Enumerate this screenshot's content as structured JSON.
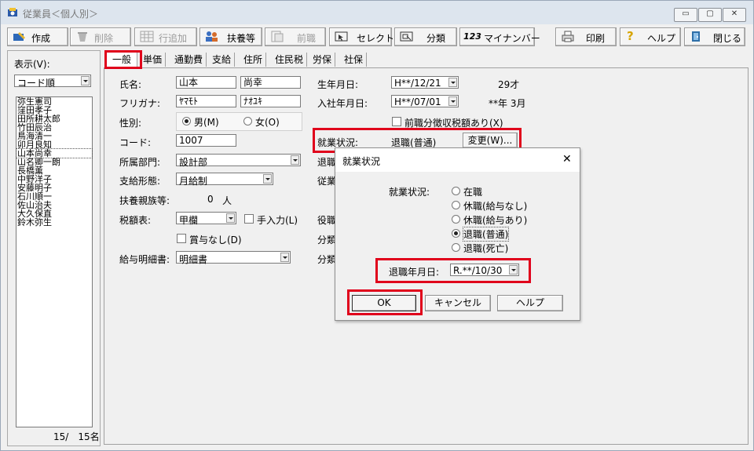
{
  "window": {
    "title": "従業員＜個人別＞",
    "minimize": "▭",
    "restore": "▢",
    "close": "✕"
  },
  "toolbar": {
    "create": "作成",
    "delete": "削除",
    "add_row": "行追加",
    "dependents": "扶養等",
    "prev_job": "前職",
    "select": "セレクト",
    "classify": "分類",
    "mynumber_icon_text": "123",
    "mynumber": "マイナンバー",
    "print": "印刷",
    "help": "ヘルプ",
    "close": "閉じる"
  },
  "left_panel": {
    "display_label": "表示(V):",
    "sort": "コード順",
    "employees": [
      "弥生憲司",
      "窪田孝子",
      "田所耕太郎",
      "竹田辰治",
      "鳥海清一",
      "卯月良知",
      "山本尚幸",
      "山名卿一朗",
      "長橋薫",
      "中野洋子",
      "安藤明子",
      "石川順一",
      "佐山治夫",
      "大久保直",
      "鈴木弥生"
    ],
    "count": "15/　15名"
  },
  "tabs": [
    "一般",
    "単価",
    "通勤費",
    "支給",
    "住所",
    "住民税",
    "労保",
    "社保"
  ],
  "form": {
    "name_label": "氏名:",
    "last_name": "山本",
    "first_name": "尚幸",
    "kana_label": "フリガナ:",
    "last_kana": "ﾔﾏﾓﾄ",
    "first_kana": "ﾅｵﾕｷ",
    "gender_label": "性別:",
    "male": "男(M)",
    "female": "女(O)",
    "code_label": "コード:",
    "code": "1007",
    "dept_label": "所属部門:",
    "dept": "設計部",
    "pay_label": "支給形態:",
    "pay": "月給制",
    "dependents_label": "扶養親族等:",
    "dependents_count": "0",
    "dependents_unit": "人",
    "tax_label": "税額表:",
    "tax": "甲欄",
    "manual_input": "手入力(L)",
    "no_bonus": "賞与なし(D)",
    "payslip_label": "給与明細書:",
    "payslip": "明細書",
    "birth_label": "生年月日:",
    "birth": "H**/12/21",
    "age": "29才",
    "hire_label": "入社年月日:",
    "hire": "H**/07/01",
    "tenure": "**年 3月",
    "prev_tax": "前職分徴収税額あり(X)",
    "status_label": "就業状況:",
    "status": "退職(普通)",
    "change_btn": "変更(W)...",
    "retire_trunc": "退職",
    "staff_trunc": "従業",
    "role_trunc": "役職",
    "class_trunc1": "分類",
    "class_trunc2": "分類"
  },
  "dialog": {
    "title": "就業状況",
    "close": "✕",
    "status_label": "就業状況:",
    "options": [
      "在職",
      "休職(給与なし)",
      "休職(給与あり)",
      "退職(普通)",
      "退職(死亡)"
    ],
    "selected_index": 3,
    "retire_date_label": "退職年月日:",
    "retire_date": "R.**/10/30",
    "ok": "OK",
    "cancel": "キャンセル",
    "help": "ヘルプ"
  }
}
